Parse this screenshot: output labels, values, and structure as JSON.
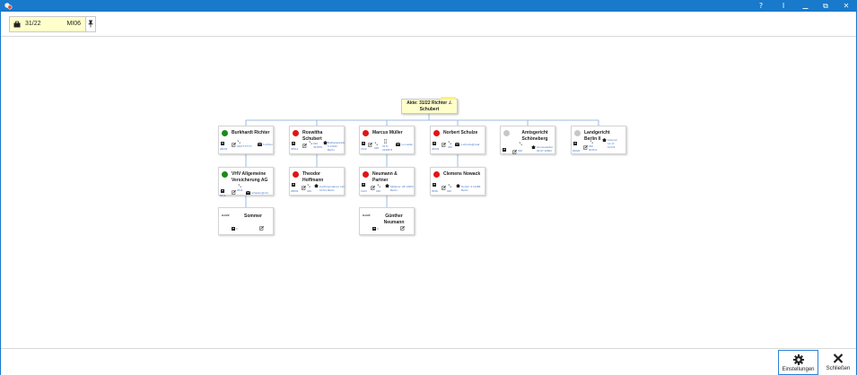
{
  "window": {
    "controls": {
      "help": "?",
      "info": "I",
      "restore": "⧉",
      "close": "✕"
    }
  },
  "header": {
    "case_number": "31/22",
    "case_code": "MI06"
  },
  "root": {
    "label": "Akte: 31/22 Richter ./. Schubert"
  },
  "cards": [
    {
      "title": "Burkhardt Richter",
      "status": "green",
      "docs": "28233",
      "phone": "0407777777",
      "email": "b.richter"
    },
    {
      "title": "Roswitha Schubert",
      "status": "red",
      "docs": "36514",
      "phone": "030 4678787",
      "address": "Rathausstraße 5 14162 Berlin"
    },
    {
      "title": "Marcus Müller",
      "status": "red",
      "docs": "1512",
      "phone": "0171 2345678",
      "mobile": "030",
      "email": "m.mueller"
    },
    {
      "title": "Norbert Schulze",
      "status": "red",
      "docs": "28233",
      "phone": "030",
      "email": "n.schulze@mail"
    },
    {
      "title": "Amtsgericht Schöneberg",
      "status": "gray",
      "docs": "",
      "phone": "030",
      "address": "Grunewaldstr. 66-67 10823"
    },
    {
      "title": "Landgericht Berlin II",
      "status": "gray",
      "docs": "81020",
      "phone": "030 9015-0",
      "address": "Littenstr. 12-17 10179"
    },
    {
      "title": "VHV Allgemeine Versicherung AG",
      "status": "green",
      "docs": "8411",
      "phone": "0511",
      "email": "schaden@vhv"
    },
    {
      "title": "Theodor Hoffmann",
      "status": "red",
      "docs": "28534",
      "phone": "030",
      "address": "Kurfürstendamm 110 10711 Berlin"
    },
    {
      "title": "Neumann & Partner",
      "status": "red",
      "docs": "1324",
      "phone": "030",
      "address": "Müllerstr. 28 13353 Berlin"
    },
    {
      "title": "Clemens Nowack",
      "status": "red",
      "docs": "5548",
      "phone": "030",
      "address": "Dorfstr. 9 12489 Berlin"
    },
    {
      "title": "Sommer",
      "status": "logo",
      "logo": "RAMP",
      "docs": "0"
    },
    {
      "title": "Günther Neumann",
      "status": "logo",
      "logo": "RAMP",
      "docs": "0"
    }
  ],
  "footer": {
    "settings_label": "Einstellungen",
    "close_label": "Schließen"
  },
  "colors": {
    "titlebar": "#1979ca",
    "note": "#ffffcc",
    "accent": "#2a82d8",
    "connector": "#9dbbe3"
  }
}
